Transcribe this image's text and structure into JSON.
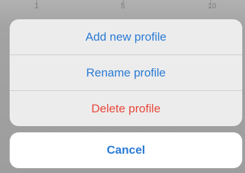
{
  "background": {
    "ruler_labels": [
      "1",
      "5",
      "10"
    ]
  },
  "action_sheet": {
    "items": [
      {
        "label": "Add new profile",
        "style": "default"
      },
      {
        "label": "Rename profile",
        "style": "default"
      },
      {
        "label": "Delete profile",
        "style": "destructive"
      }
    ],
    "cancel_label": "Cancel"
  },
  "colors": {
    "accent": "#2a7bd6",
    "destructive": "#e8473a",
    "sheet_background": "#ececec",
    "cancel_background": "#ffffff"
  }
}
